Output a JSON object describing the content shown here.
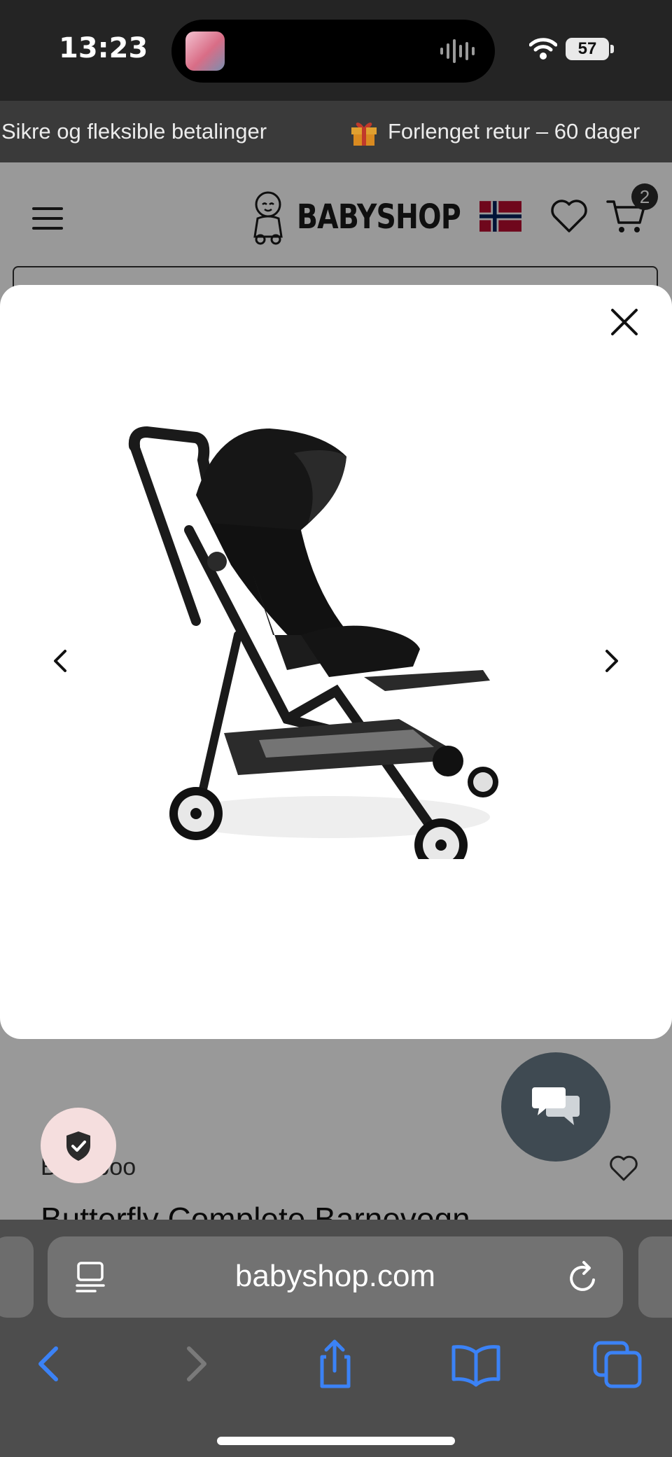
{
  "status_bar": {
    "time": "13:23",
    "battery": "57"
  },
  "banner": {
    "text_1": "Sikre og fleksible betalinger",
    "text_2": "Forlenget retur – 60 dager"
  },
  "header": {
    "logo": "BABYSHOP",
    "cart_count": "2"
  },
  "product": {
    "brand": "Bugaboo",
    "title": "Butterfly Complete Barnevogn"
  },
  "browser": {
    "url": "babyshop.com"
  },
  "colors": {
    "accent_blue": "#3b82f6",
    "chat_button": "#3f4a52",
    "shield_button": "#f5dede"
  },
  "icons": {
    "gallery": [
      "close-icon",
      "chevron-left-icon",
      "chevron-right-icon"
    ],
    "header": [
      "menu-icon",
      "norway-flag-icon",
      "heart-icon",
      "cart-icon"
    ],
    "toolbar": [
      "back-icon",
      "forward-icon",
      "share-icon",
      "bookmarks-icon",
      "tabs-icon"
    ]
  }
}
